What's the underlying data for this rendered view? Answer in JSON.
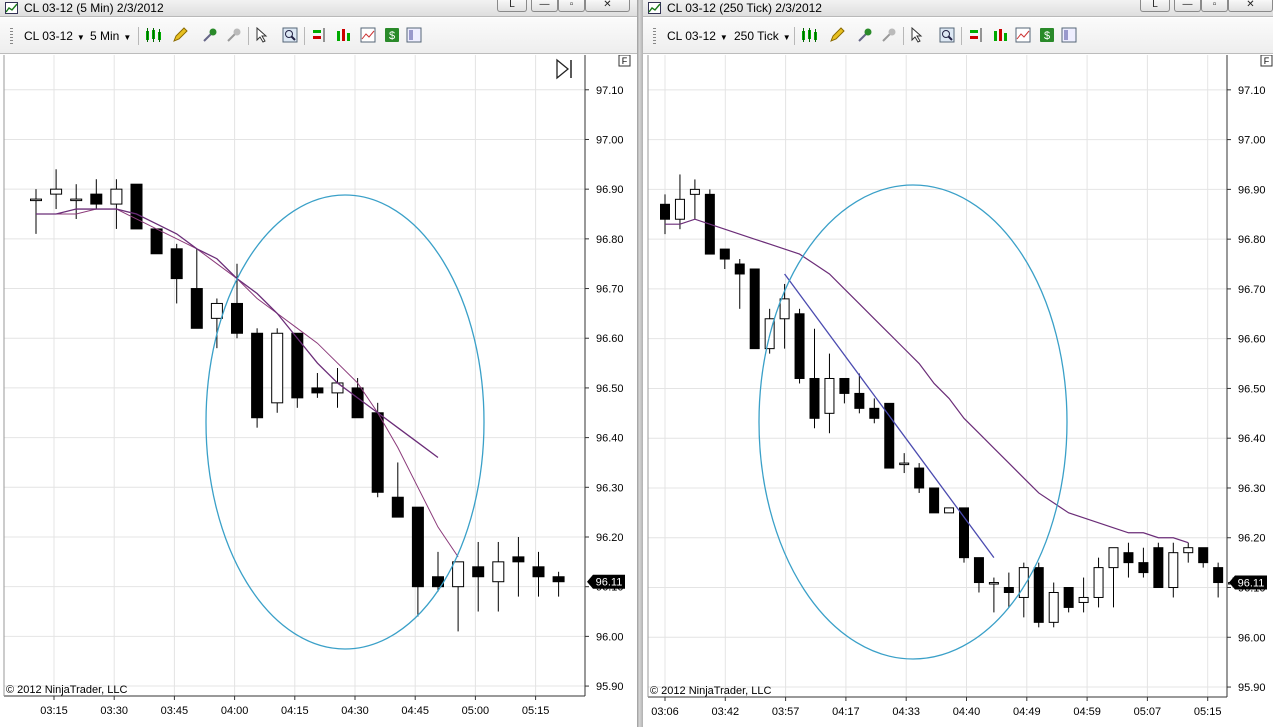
{
  "left_window": {
    "title": "CL 03-12 (5 Min)  2/3/2012",
    "instrument": "CL 03-12",
    "interval": "5 Min",
    "min_label": "L",
    "restore_label": "▫",
    "close_label": "✕",
    "copyright": "© 2012 NinjaTrader, LLC",
    "price_marker": "96.11",
    "f_badge": "F",
    "colors": {
      "ema_fast": "#8b3a7a",
      "ema_slow": "#6b2d78",
      "circle": "#3aa0c8"
    }
  },
  "right_window": {
    "title": "CL 03-12 (250 Tick)  2/3/2012",
    "instrument": "CL 03-12",
    "interval": "250 Tick",
    "min_label": "L",
    "restore_label": "▫",
    "close_label": "✕",
    "copyright": "© 2012 NinjaTrader, LLC",
    "price_marker": "96.11",
    "f_badge": "F",
    "colors": {
      "ema": "#6b2d78",
      "trendline": "#4b4bb0",
      "circle": "#3aa0c8"
    }
  },
  "chart_data": [
    {
      "type": "candlestick",
      "title": "CL 03-12 (5 Min)  2/3/2012",
      "ylim": [
        95.88,
        97.17
      ],
      "y_ticks": [
        "97.10",
        "97.00",
        "96.90",
        "96.80",
        "96.70",
        "96.60",
        "96.50",
        "96.40",
        "96.30",
        "96.20",
        "96.10",
        "96.00",
        "95.90"
      ],
      "x_ticks": [
        "03:15",
        "03:30",
        "03:45",
        "04:00",
        "04:15",
        "04:30",
        "04:45",
        "05:00",
        "05:15"
      ],
      "current_price": 96.11,
      "candles": [
        {
          "o": 96.88,
          "h": 96.9,
          "l": 96.81,
          "c": 96.88
        },
        {
          "o": 96.89,
          "h": 96.94,
          "l": 96.86,
          "c": 96.9
        },
        {
          "o": 96.88,
          "h": 96.91,
          "l": 96.84,
          "c": 96.88
        },
        {
          "o": 96.89,
          "h": 96.92,
          "l": 96.86,
          "c": 96.87
        },
        {
          "o": 96.87,
          "h": 96.92,
          "l": 96.82,
          "c": 96.9
        },
        {
          "o": 96.91,
          "h": 96.91,
          "l": 96.82,
          "c": 96.82
        },
        {
          "o": 96.82,
          "h": 96.82,
          "l": 96.77,
          "c": 96.77
        },
        {
          "o": 96.78,
          "h": 96.79,
          "l": 96.67,
          "c": 96.72
        },
        {
          "o": 96.7,
          "h": 96.78,
          "l": 96.62,
          "c": 96.62
        },
        {
          "o": 96.64,
          "h": 96.68,
          "l": 96.58,
          "c": 96.67
        },
        {
          "o": 96.67,
          "h": 96.75,
          "l": 96.6,
          "c": 96.61
        },
        {
          "o": 96.61,
          "h": 96.62,
          "l": 96.42,
          "c": 96.44
        },
        {
          "o": 96.47,
          "h": 96.62,
          "l": 96.45,
          "c": 96.61
        },
        {
          "o": 96.61,
          "h": 96.61,
          "l": 96.46,
          "c": 96.48
        },
        {
          "o": 96.5,
          "h": 96.53,
          "l": 96.48,
          "c": 96.49
        },
        {
          "o": 96.49,
          "h": 96.54,
          "l": 96.46,
          "c": 96.51
        },
        {
          "o": 96.5,
          "h": 96.52,
          "l": 96.44,
          "c": 96.44
        },
        {
          "o": 96.45,
          "h": 96.47,
          "l": 96.28,
          "c": 96.29
        },
        {
          "o": 96.28,
          "h": 96.35,
          "l": 96.24,
          "c": 96.24
        },
        {
          "o": 96.26,
          "h": 96.26,
          "l": 96.04,
          "c": 96.1
        },
        {
          "o": 96.12,
          "h": 96.17,
          "l": 96.09,
          "c": 96.1
        },
        {
          "o": 96.1,
          "h": 96.15,
          "l": 96.01,
          "c": 96.15
        },
        {
          "o": 96.14,
          "h": 96.19,
          "l": 96.05,
          "c": 96.12
        },
        {
          "o": 96.11,
          "h": 96.19,
          "l": 96.05,
          "c": 96.15
        },
        {
          "o": 96.16,
          "h": 96.2,
          "l": 96.08,
          "c": 96.15
        },
        {
          "o": 96.14,
          "h": 96.17,
          "l": 96.08,
          "c": 96.12
        },
        {
          "o": 96.12,
          "h": 96.13,
          "l": 96.08,
          "c": 96.11
        }
      ],
      "ema_fast": [
        96.85,
        96.85,
        96.85,
        96.86,
        96.86,
        96.84,
        96.82,
        96.8,
        96.78,
        96.75,
        96.72,
        96.68,
        96.65,
        96.62,
        96.59,
        96.55,
        96.51,
        96.45,
        96.38,
        96.3,
        96.22,
        96.16
      ],
      "ema_slow": [
        96.85,
        96.85,
        96.86,
        96.86,
        96.86,
        96.85,
        96.83,
        96.81,
        96.78,
        96.76,
        96.72,
        96.69,
        96.65,
        96.6,
        96.55,
        96.51,
        96.48,
        96.45,
        96.42,
        96.39,
        96.36
      ]
    },
    {
      "type": "candlestick",
      "title": "CL 03-12 (250 Tick)  2/3/2012",
      "ylim": [
        95.88,
        97.17
      ],
      "y_ticks": [
        "97.10",
        "97.00",
        "96.90",
        "96.80",
        "96.70",
        "96.60",
        "96.50",
        "96.40",
        "96.30",
        "96.20",
        "96.10",
        "96.00",
        "95.90"
      ],
      "x_ticks": [
        "03:06",
        "03:42",
        "03:57",
        "04:17",
        "04:33",
        "04:40",
        "04:49",
        "04:59",
        "05:07",
        "05:15"
      ],
      "current_price": 96.11,
      "candles": [
        {
          "o": 96.87,
          "h": 96.89,
          "l": 96.81,
          "c": 96.84
        },
        {
          "o": 96.84,
          "h": 96.93,
          "l": 96.82,
          "c": 96.88
        },
        {
          "o": 96.89,
          "h": 96.92,
          "l": 96.84,
          "c": 96.9
        },
        {
          "o": 96.89,
          "h": 96.9,
          "l": 96.77,
          "c": 96.77
        },
        {
          "o": 96.78,
          "h": 96.78,
          "l": 96.74,
          "c": 96.76
        },
        {
          "o": 96.75,
          "h": 96.76,
          "l": 96.66,
          "c": 96.73
        },
        {
          "o": 96.74,
          "h": 96.74,
          "l": 96.58,
          "c": 96.58
        },
        {
          "o": 96.58,
          "h": 96.66,
          "l": 96.57,
          "c": 96.64
        },
        {
          "o": 96.64,
          "h": 96.71,
          "l": 96.58,
          "c": 96.68
        },
        {
          "o": 96.65,
          "h": 96.66,
          "l": 96.51,
          "c": 96.52
        },
        {
          "o": 96.52,
          "h": 96.62,
          "l": 96.42,
          "c": 96.44
        },
        {
          "o": 96.45,
          "h": 96.57,
          "l": 96.41,
          "c": 96.52
        },
        {
          "o": 96.52,
          "h": 96.52,
          "l": 96.47,
          "c": 96.49
        },
        {
          "o": 96.49,
          "h": 96.53,
          "l": 96.45,
          "c": 96.46
        },
        {
          "o": 96.46,
          "h": 96.48,
          "l": 96.43,
          "c": 96.44
        },
        {
          "o": 96.47,
          "h": 96.47,
          "l": 96.34,
          "c": 96.34
        },
        {
          "o": 96.35,
          "h": 96.37,
          "l": 96.33,
          "c": 96.35
        },
        {
          "o": 96.34,
          "h": 96.35,
          "l": 96.29,
          "c": 96.3
        },
        {
          "o": 96.3,
          "h": 96.3,
          "l": 96.25,
          "c": 96.25
        },
        {
          "o": 96.25,
          "h": 96.26,
          "l": 96.25,
          "c": 96.26
        },
        {
          "o": 96.26,
          "h": 96.26,
          "l": 96.15,
          "c": 96.16
        },
        {
          "o": 96.16,
          "h": 96.16,
          "l": 96.09,
          "c": 96.11
        },
        {
          "o": 96.11,
          "h": 96.12,
          "l": 96.05,
          "c": 96.11
        },
        {
          "o": 96.1,
          "h": 96.13,
          "l": 96.06,
          "c": 96.09
        },
        {
          "o": 96.08,
          "h": 96.15,
          "l": 96.04,
          "c": 96.14
        },
        {
          "o": 96.14,
          "h": 96.15,
          "l": 96.02,
          "c": 96.03
        },
        {
          "o": 96.03,
          "h": 96.11,
          "l": 96.02,
          "c": 96.09
        },
        {
          "o": 96.1,
          "h": 96.1,
          "l": 96.05,
          "c": 96.06
        },
        {
          "o": 96.07,
          "h": 96.12,
          "l": 96.05,
          "c": 96.08
        },
        {
          "o": 96.08,
          "h": 96.16,
          "l": 96.06,
          "c": 96.14
        },
        {
          "o": 96.14,
          "h": 96.18,
          "l": 96.06,
          "c": 96.18
        },
        {
          "o": 96.17,
          "h": 96.19,
          "l": 96.12,
          "c": 96.15
        },
        {
          "o": 96.15,
          "h": 96.18,
          "l": 96.12,
          "c": 96.13
        },
        {
          "o": 96.18,
          "h": 96.19,
          "l": 96.1,
          "c": 96.1
        },
        {
          "o": 96.1,
          "h": 96.19,
          "l": 96.08,
          "c": 96.17
        },
        {
          "o": 96.17,
          "h": 96.19,
          "l": 96.15,
          "c": 96.18
        },
        {
          "o": 96.18,
          "h": 96.18,
          "l": 96.14,
          "c": 96.15
        },
        {
          "o": 96.14,
          "h": 96.15,
          "l": 96.08,
          "c": 96.11
        },
        {
          "o": 96.11,
          "h": 96.12,
          "l": 96.1,
          "c": 96.11
        }
      ],
      "ema": [
        96.83,
        96.83,
        96.84,
        96.83,
        96.82,
        96.81,
        96.8,
        96.79,
        96.78,
        96.77,
        96.75,
        96.73,
        96.7,
        96.67,
        96.64,
        96.61,
        96.58,
        96.55,
        96.51,
        96.48,
        96.44,
        96.41,
        96.38,
        96.35,
        96.32,
        96.29,
        96.27,
        96.25,
        96.24,
        96.23,
        96.22,
        96.21,
        96.21,
        96.2,
        96.2,
        96.19
      ],
      "trendline": {
        "from_index": 8,
        "from_price": 96.73,
        "to_index": 22,
        "to_price": 96.16
      }
    }
  ]
}
